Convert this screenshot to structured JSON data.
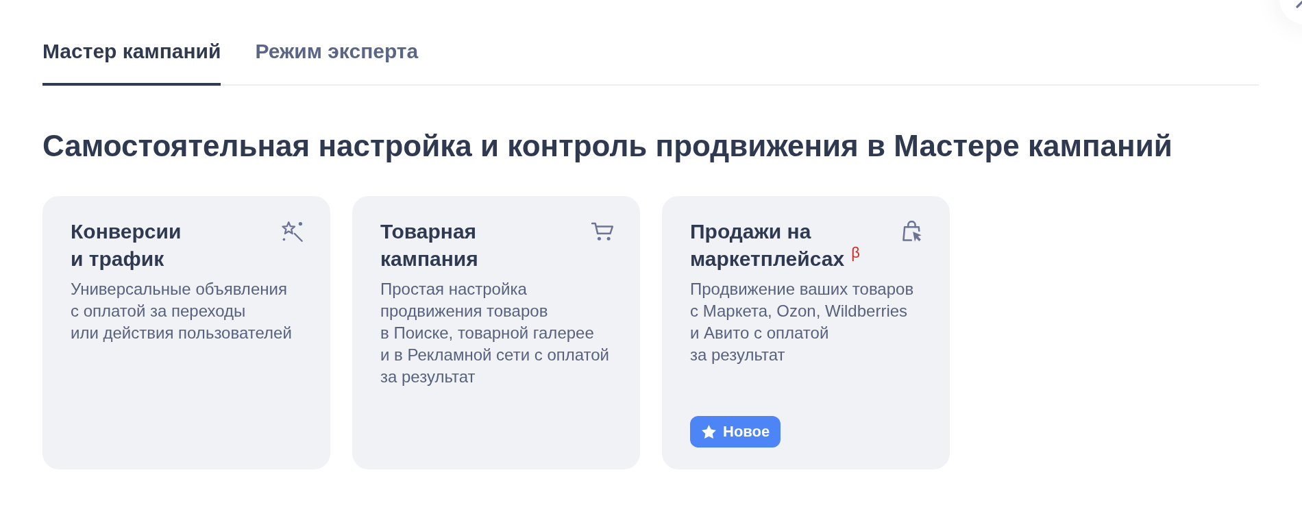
{
  "tabs": [
    {
      "label": "Мастер кампаний",
      "selected": true
    },
    {
      "label": "Режим эксперта",
      "selected": false
    }
  ],
  "heading": "Самостоятельная настройка и контроль продвижения в Мастере кампаний",
  "cards": [
    {
      "title": "Конверсии\nи трафик",
      "description": "Универсальные объявления\nс оплатой за переходы\nили действия пользователей"
    },
    {
      "title": "Товарная\nкампания",
      "description": "Простая настройка\nпродвижения товаров\nв Поиске, товарной галерее\nи в Рекламной сети с оплатой\nза результат"
    },
    {
      "title": "Продажи на\nмаркетплейсах",
      "tag": "β",
      "description": "Продвижение ваших товаров\nс Маркета, Ozon, Wildberries\nи Авито с оплатой\nза результат",
      "badge": {
        "label": "Новое"
      }
    }
  ]
}
